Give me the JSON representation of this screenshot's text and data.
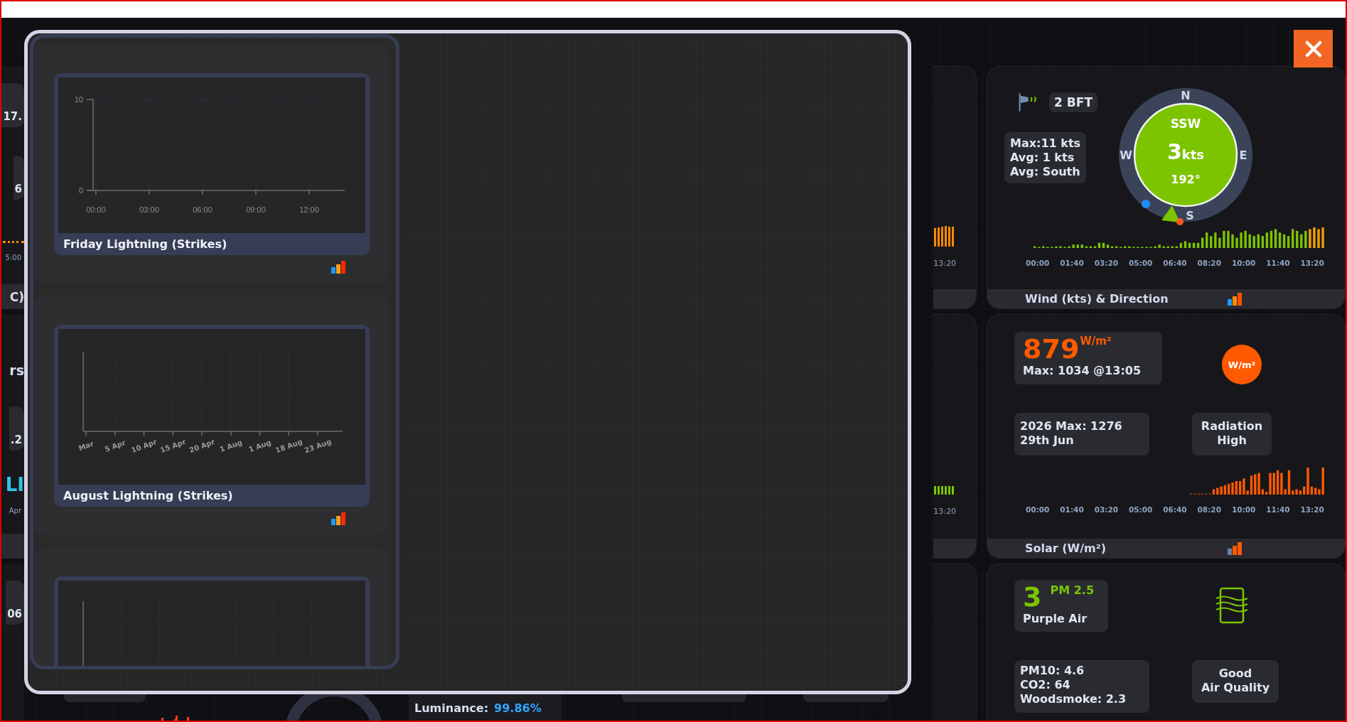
{
  "modal": {
    "charts": [
      {
        "kind": "chart",
        "chart_data": {
          "type": "bar",
          "grid": true,
          "title": "Friday Lightning (Strikes)",
          "xticks": [
            {
              "value": 0,
              "label": "00:00"
            },
            {
              "value": 3,
              "label": "03:00"
            },
            {
              "value": 6,
              "label": "06:00"
            },
            {
              "value": 9,
              "label": "09:00"
            },
            {
              "value": 12,
              "label": "12:00"
            }
          ],
          "xlim": [
            0,
            14
          ],
          "yticks": [
            0,
            10
          ],
          "ylim": [
            0,
            10
          ]
        }
      },
      {
        "kind": "chart",
        "chart_data": {
          "type": "other",
          "title": "August Lightning (Strikes)",
          "categories": [
            "Mar",
            "5 Apr",
            "10 Apr",
            "15 Apr",
            "20 Apr",
            "1 Aug",
            "1 Aug",
            "18 Aug",
            "23 Aug"
          ]
        }
      },
      {
        "kind": "cut_off"
      }
    ]
  },
  "left_edge_cards": [
    {
      "items": [
        {
          "kind": "pill",
          "text": "17."
        },
        {
          "kind": "pill",
          "text": "6"
        },
        {
          "kind": "trace"
        },
        {
          "kind": "axis",
          "text": "5:00"
        }
      ],
      "footer_bar": true,
      "footer_title": "C)"
    },
    {
      "items": [
        {
          "kind": "heading",
          "text": "rs"
        },
        {
          "kind": "pill",
          "text": ".2"
        },
        {
          "kind": "accent",
          "text": "LI"
        },
        {
          "kind": "axis",
          "text": "Apr"
        }
      ],
      "footer_bar": true
    },
    {
      "items": [
        {
          "kind": "pill",
          "text": "06"
        }
      ],
      "footer_bar": false
    }
  ],
  "mid_strip_cards": [
    {
      "kind": "bars",
      "color": "#ff8a00",
      "axis_label": "13:20"
    },
    {
      "kind": "bars",
      "color": "#7cc400",
      "axis_label": "13:20"
    },
    {
      "kind": "blank"
    }
  ],
  "bottom_row": {
    "luminance": {
      "label": "Luminance:",
      "value": "99.86%"
    }
  },
  "wind": {
    "beaufort": "2 BFT",
    "stats": [
      "Max:11 kts",
      "Avg: 1 kts",
      "Avg: South"
    ],
    "compass": {
      "direction": "SSW",
      "speed": "3",
      "speed_unit": "kts",
      "bearing": "192°",
      "points": [
        "N",
        "E",
        "S",
        "W"
      ]
    },
    "axis_labels": [
      "00:00",
      "01:40",
      "03:20",
      "05:00",
      "06:40",
      "08:20",
      "10:00",
      "11:40",
      "13:20"
    ],
    "title": "Wind (kts) & Direction"
  },
  "solar": {
    "value": "879",
    "unit": "W/m²",
    "max": "Max: 1034 @13:05",
    "badge": "W/m²",
    "year_max": [
      "2026 Max: 1276",
      "29th Jun"
    ],
    "level": [
      "Radiation",
      "High"
    ],
    "axis_labels": [
      "00:00",
      "01:40",
      "03:20",
      "05:00",
      "06:40",
      "08:20",
      "10:00",
      "11:40",
      "13:20"
    ],
    "title": "Solar (W/m²)"
  },
  "air": {
    "value": "3",
    "unit": "PM 2.5",
    "source": "Purple Air",
    "readings": [
      "PM10: 4.6",
      "CO2: 64",
      "Woodsmoke: 2.3"
    ],
    "quality": [
      "Good",
      "Air Quality"
    ]
  }
}
